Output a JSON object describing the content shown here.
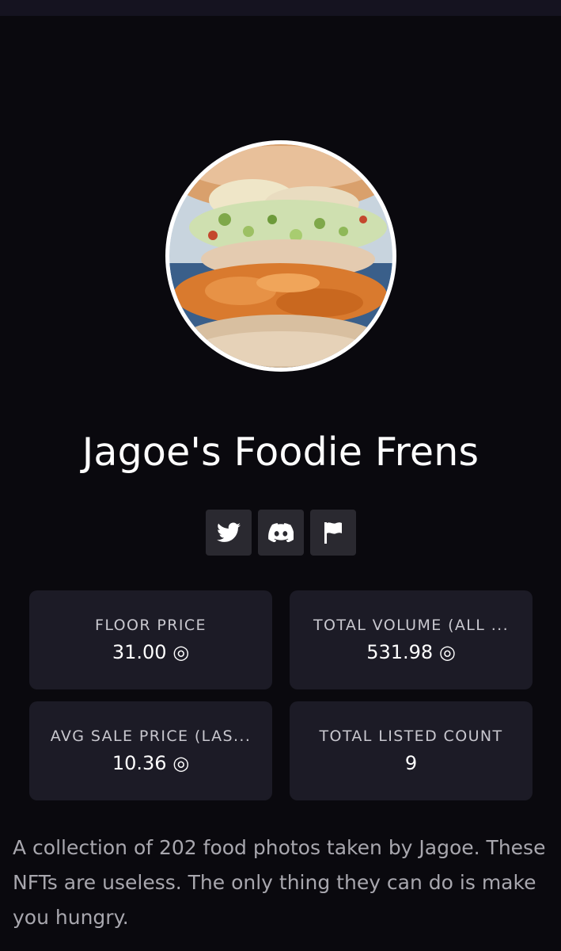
{
  "collection": {
    "name": "Jagoe's Foodie Frens",
    "description": "A collection of 202 food photos taken by Jagoe. These NFTs are useless. The only thing they can do is make you hungry."
  },
  "socials": [
    {
      "icon": "twitter-icon"
    },
    {
      "icon": "discord-icon"
    },
    {
      "icon": "flag-icon"
    }
  ],
  "stats": [
    {
      "label": "FLOOR PRICE",
      "value": "31.00 ◎"
    },
    {
      "label": "TOTAL VOLUME (ALL ...",
      "value": "531.98 ◎"
    },
    {
      "label": "AVG SALE PRICE (LAS...",
      "value": "10.36 ◎"
    },
    {
      "label": "TOTAL LISTED COUNT",
      "value": "9"
    }
  ],
  "colors": {
    "background": "#0a090e",
    "card": "#1c1b26",
    "social_button": "#2a2930",
    "description_text": "#a8a7ae"
  }
}
